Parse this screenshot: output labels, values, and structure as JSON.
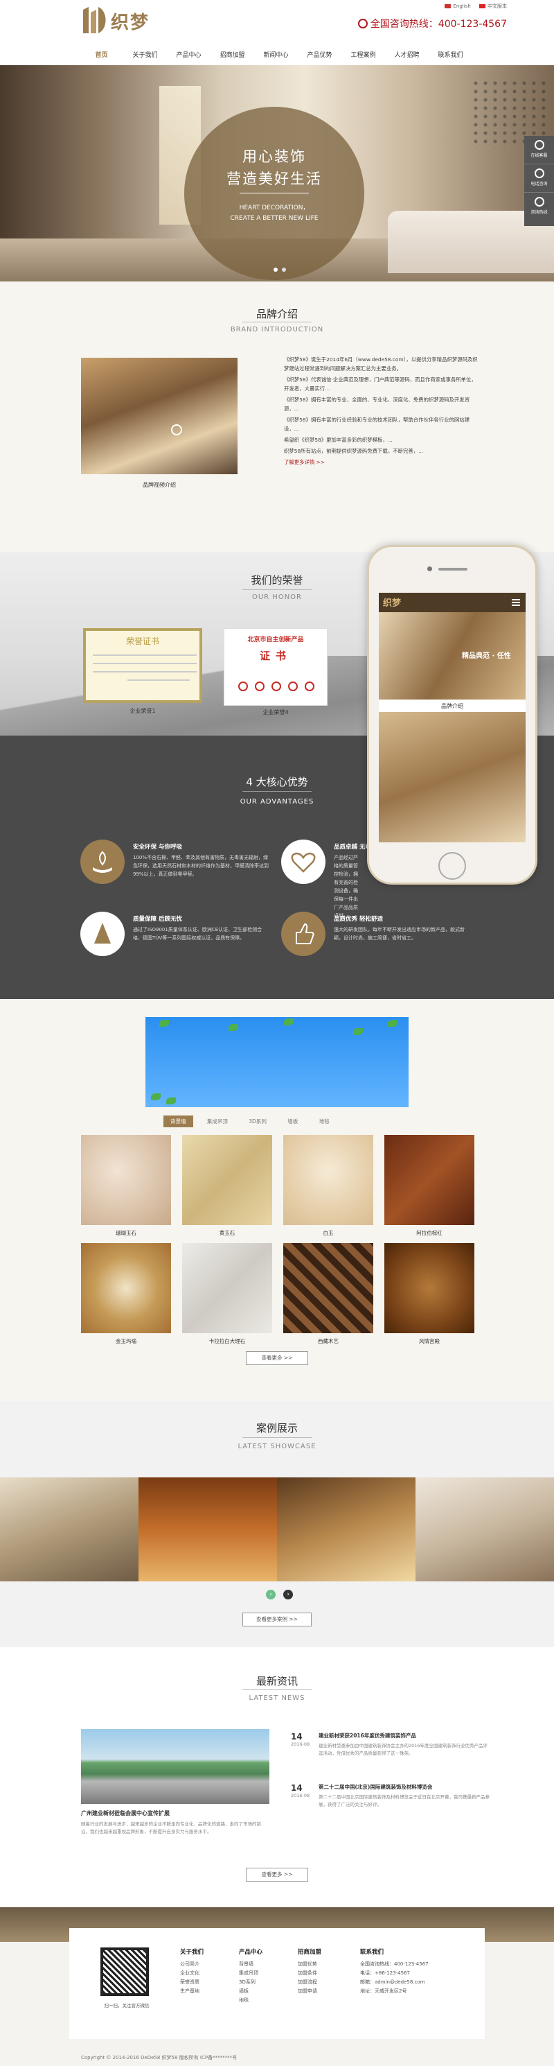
{
  "header": {
    "brand": "织梦",
    "lang_en": "English",
    "lang_cn": "中文版本",
    "hotline": "全国咨询热线：400-123-4567"
  },
  "nav": [
    "首页",
    "关于我们",
    "产品中心",
    "招商加盟",
    "新闻中心",
    "产品优势",
    "工程案例",
    "人才招聘",
    "联系我们"
  ],
  "hero": {
    "line1": "用心装饰",
    "line2": "营造美好生活",
    "line3": "HEART DECORATION，",
    "line4": "CREATE A BETTER NEW LIFE"
  },
  "side": [
    "在线客服",
    "电话咨询",
    "咨询热线"
  ],
  "brand": {
    "title": "品牌介绍",
    "sub": "BRAND INTRODUCTION",
    "caption": "品牌视频介绍",
    "paras": [
      "《织梦58》诞生于2014年6月（www.dede58.com），以提供分享精品织梦源码及织梦建站过程常遇到的问题解决方案汇总为主要业务。",
      "《织梦58》代表诚信·企业典范及理想，门户典范等源码，而且作商家或事务所单位，开发者，大量实行...",
      "《织梦58》拥有丰富的专业、全面的、专业化、深度化、免费的织梦源码及开发资源，...",
      "《织梦58》拥有丰富的行业经验和专业的技术团队，帮助合作伙伴各行业的网站建设，...",
      "希望织《织梦58》更加丰富多彩的织梦模板，...",
      "织梦58所有站点，前期提供织梦源码免费下载，不断完善，..."
    ],
    "more": "了解更多详情 >>"
  },
  "honor": {
    "title": "我们的荣誉",
    "sub": "OUR HONOR",
    "cert1_title": "荣誉证书",
    "cert2_title1": "北京市自主创新产品",
    "cert2_title2": "证书",
    "cap1": "企业荣誉1",
    "cap2": "企业荣誉4"
  },
  "phone": {
    "logo": "织梦",
    "slogan": "精品典范 · 任性",
    "caption": "品牌介绍"
  },
  "adv": {
    "title": "4 大核心优势",
    "sub": "OUR ADVANTAGES",
    "items": [
      {
        "h": "安全环保 与你呼吸",
        "p": "100%不含石棉、甲醛、苯及其他有害物质，无毒害无辐射，绿色环保，选用天然石材和木材的纤维作为基材，甲醛清除率达到99%以上，真正做到零甲醛。"
      },
      {
        "h": "品质卓越 无可比拟",
        "p": "产品经过严格的质量管控检验，拥有完善的检测设备，确保每一件出厂产品品质卓越。"
      },
      {
        "h": "质量保障 后顾无忧",
        "p": "通过了ISO9001质量体系认证、欧洲CE认证、卫生部检测合格、德国TÜV等一系列国际权威认证，品质有保障。"
      },
      {
        "h": "品质优秀 轻松舒适",
        "p": "强大的研发团队，每年不断开发出适应市场的新产品，款式新颖，设计时尚，施工简便，省时省工。"
      }
    ]
  },
  "prod": {
    "tabs": [
      "背景墙",
      "集成吊顶",
      "3D系列",
      "墙板",
      "地毯"
    ],
    "items": [
      "珊瑚玉石",
      "黄玉石",
      "白玉",
      "阿拉伯棕红",
      "金玉玛瑙",
      "卡拉拉白大理石",
      "西藏木艺",
      "风情宫殿"
    ],
    "more": "查看更多 >>"
  },
  "cases": {
    "title": "案例展示",
    "sub": "LATEST SHOWCASE",
    "prev": "‹",
    "next": "›",
    "more": "查看更多案例 >>"
  },
  "news": {
    "title": "最新资讯",
    "sub": "LATEST NEWS",
    "img_title": "广州建业新材莅临会展中心宣传扩展",
    "img_desc": "随着行业的发展与进步，越来越多的企业不断走向专业化、品牌化的道路，走向了市场的前沿，我们也越来越重视品牌形象，不断提升自身实力与服务水平。",
    "items": [
      {
        "d": "14",
        "y": "2016-08",
        "h": "建业新材荣获2016年度优秀建筑装饰产品",
        "p": "建业新材受邀参加由中国建筑装饰协会主办的2016年度全国建筑装饰行业优秀产品评选活动，凭借优秀的产品质量获得了这一殊荣。"
      },
      {
        "d": "14",
        "y": "2016-08",
        "h": "第二十二届中国(北京)国际建筑装饰及材料博览会",
        "p": "第二十二届中国北京国际建筑装饰及材料博览会于近日在北京开幕，我司携最新产品参展，获得了广泛的关注与好评。"
      }
    ],
    "more": "查看更多 >>"
  },
  "footer": {
    "qr_cap": "扫一扫，关注官方微信",
    "cols": [
      {
        "h": "关于我们",
        "items": [
          "公司简介",
          "企业文化",
          "荣誉资质",
          "生产基地"
        ]
      },
      {
        "h": "产品中心",
        "items": [
          "背景墙",
          "集成吊顶",
          "3D系列",
          "墙板",
          "地毯"
        ]
      },
      {
        "h": "招商加盟",
        "items": [
          "加盟优势",
          "加盟条件",
          "加盟流程",
          "加盟申请"
        ]
      },
      {
        "h": "联系我们",
        "items": [
          "全国咨询热线：400-123-4567",
          "电话：+86-123-4567",
          "邮箱：admin@dede58.com",
          "地址：天威开发区2号"
        ]
      }
    ],
    "copyright": "Copyright © 2014-2016 DeDe58 织梦58 版权所有    ICP备********号"
  }
}
